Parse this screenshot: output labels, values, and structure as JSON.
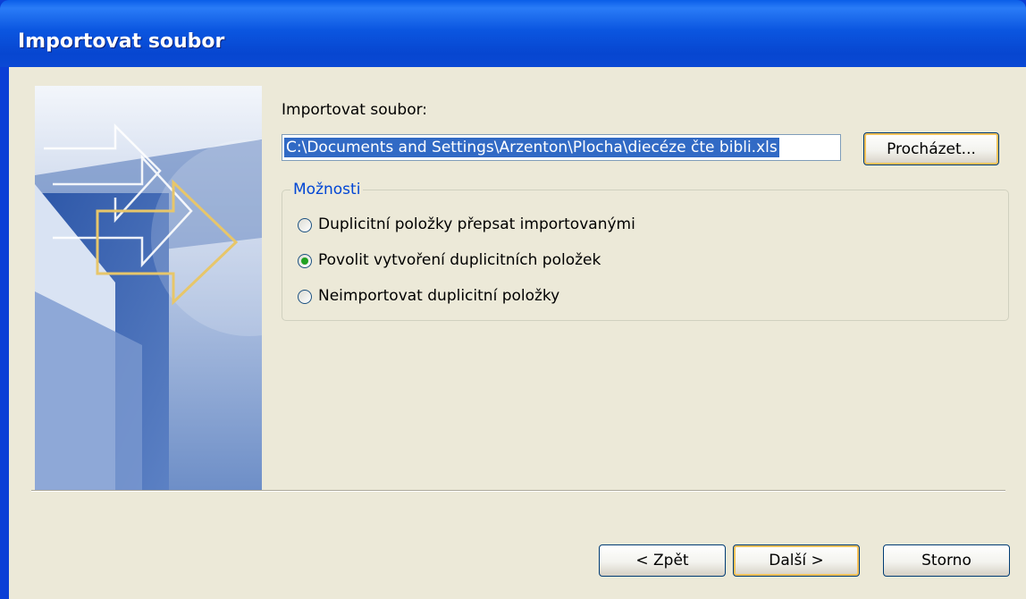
{
  "window": {
    "title": "Importovat soubor"
  },
  "file": {
    "label": "Importovat soubor:",
    "path": "C:\\Documents and Settings\\Arzenton\\Plocha\\diecéze čte bibli.xls",
    "browse_label": "Procházet..."
  },
  "options": {
    "group_label": "Možnosti",
    "items": [
      {
        "label": "Duplicitní položky přepsat importovanými",
        "selected": false
      },
      {
        "label": "Povolit vytvoření duplicitních položek",
        "selected": true
      },
      {
        "label": "Neimportovat duplicitní položky",
        "selected": false
      }
    ]
  },
  "footer": {
    "back_label": "< Zpět",
    "next_label": "Další >",
    "cancel_label": "Storno"
  }
}
